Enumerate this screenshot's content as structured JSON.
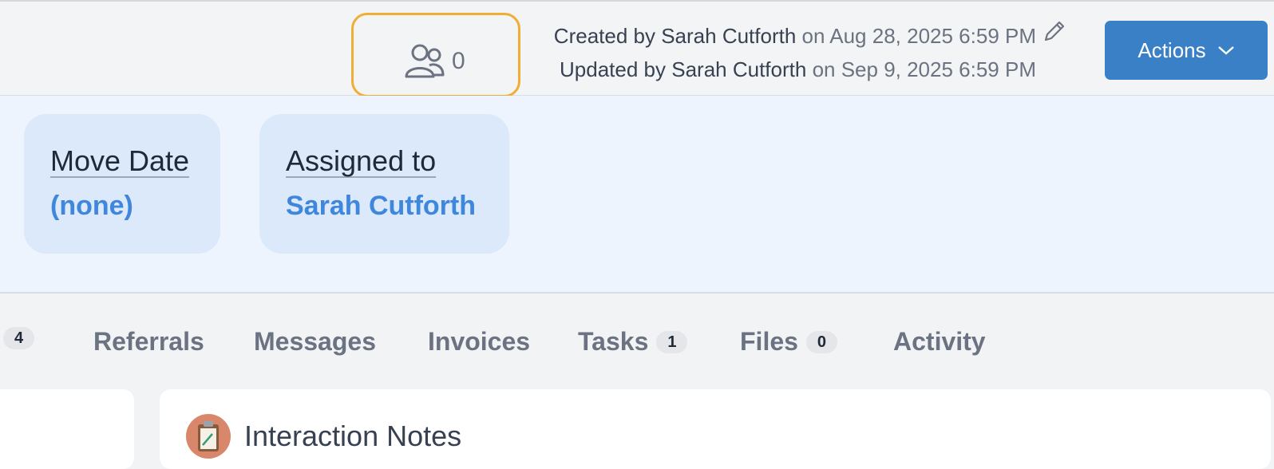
{
  "header": {
    "followers_count": "0",
    "created_prefix": "Created by",
    "created_by": "Sarah Cutforth",
    "created_on": "on Aug 28, 2025 6:59 PM",
    "updated_prefix": "Updated by",
    "updated_by": "Sarah Cutforth",
    "updated_on": "on Sep 9, 2025 6:59 PM",
    "actions_label": "Actions",
    "icons": [
      "users-icon",
      "pencil-icon",
      "chevron-down-icon"
    ]
  },
  "summary_cards": [
    {
      "label": "Move Date",
      "value": "(none)"
    },
    {
      "label": "Assigned to",
      "value": "Sarah Cutforth"
    }
  ],
  "tabs": {
    "partial_badge": "4",
    "items": [
      {
        "label": "Referrals"
      },
      {
        "label": "Messages"
      },
      {
        "label": "Invoices"
      },
      {
        "label": "Tasks",
        "badge": "1"
      },
      {
        "label": "Files",
        "badge": "0"
      },
      {
        "label": "Activity"
      }
    ]
  },
  "panel": {
    "title": "Interaction Notes",
    "icon": "clipboard-icon"
  },
  "colors": {
    "accent": "#3a80c6",
    "link": "#3f87dc",
    "highlight": "#f1ae34",
    "card_bg": "#dbe9fa"
  }
}
